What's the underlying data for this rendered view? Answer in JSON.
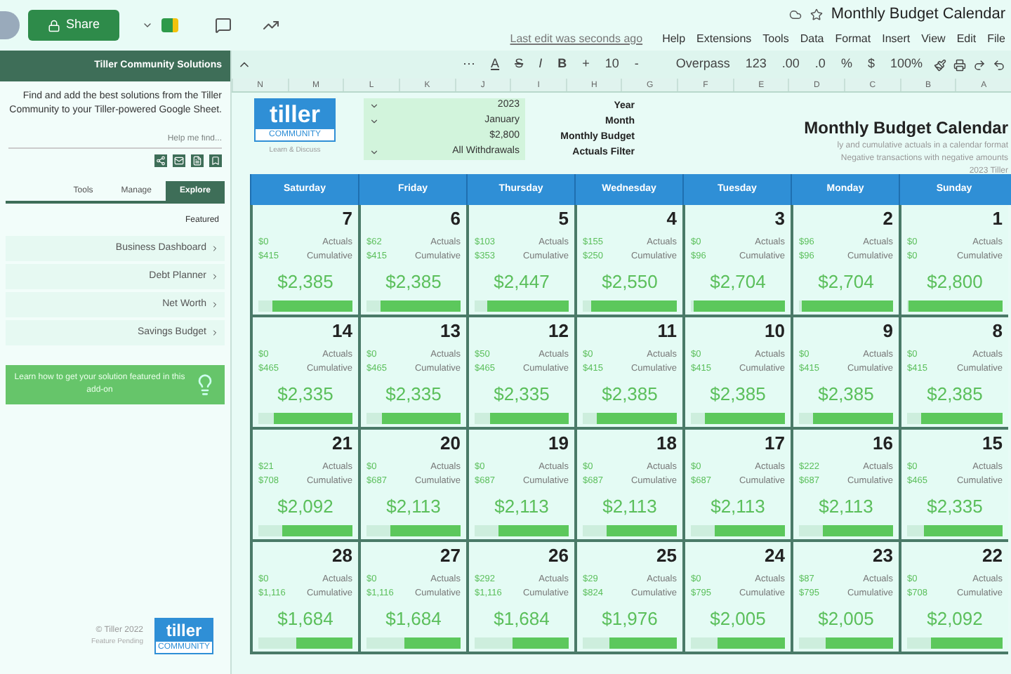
{
  "document": {
    "share": "Share",
    "last_edit": "Last edit was seconds ago",
    "menus": [
      "Help",
      "Extensions",
      "Tools",
      "Data",
      "Format",
      "Insert",
      "View",
      "Edit",
      "File"
    ],
    "title": "Monthly Budget Calendar"
  },
  "toolbar": {
    "more": "⋯",
    "text_color": "A",
    "strike": "S",
    "italic": "I",
    "bold": "B",
    "plus": "+",
    "font_size": "10",
    "minus": "-",
    "font": "Overpass",
    "number_format": "123",
    "decimals_more": ".00",
    "decimals_less": ".0",
    "percent": "%",
    "currency": "$",
    "zoom": "100%"
  },
  "sidebar": {
    "title": "Tiller Community Solutions",
    "intro": "Find and add the best solutions from the Tiller Community to your Tiller-powered Google Sheet.",
    "search": {
      "placeholder": "Help me find..."
    },
    "tabs": [
      {
        "label": "Tools",
        "selected": false
      },
      {
        "label": "Manage",
        "selected": false
      },
      {
        "label": "Explore",
        "selected": true
      }
    ],
    "section": "Featured",
    "items": [
      "Business Dashboard",
      "Debt Planner",
      "Net Worth",
      "Savings Budget"
    ],
    "banner": "Learn how to get your solution featured in this add-on",
    "footer": {
      "logo_word": "tiller",
      "logo_tag": "COMMUNITY",
      "copyright": "© Tiller 2022",
      "note": "Feature Pending"
    }
  },
  "columns": [
    "N",
    "M",
    "L",
    "K",
    "J",
    "I",
    "H",
    "G",
    "F",
    "E",
    "D",
    "C",
    "B",
    "A"
  ],
  "sheet": {
    "logo_word": "tiller",
    "logo_tag": "COMMUNITY",
    "logo_caption": "Learn & Discuss",
    "settings": [
      {
        "label": "Year",
        "value": "2023",
        "dropdown": true
      },
      {
        "label": "Month",
        "value": "January",
        "dropdown": true
      },
      {
        "label": "Monthly Budget",
        "value": "$2,800",
        "dropdown": false
      },
      {
        "label": "Actuals Filter",
        "value": "All Withdrawals",
        "dropdown": true
      }
    ],
    "title": "Monthly Budget Calendar",
    "description": [
      "ly and cumulative actuals in a calendar format",
      "Negative transactions with negative amounts",
      "2023 Tiller"
    ],
    "weekdays": [
      "Saturday",
      "Friday",
      "Thursday",
      "Wednesday",
      "Tuesday",
      "Monday",
      "Sunday"
    ],
    "weeks": [
      [
        {
          "day": "7",
          "actuals": "$0",
          "cumulative": "$415",
          "remaining": "$2,385",
          "level": 0.85,
          "actuals_label": "Actuals",
          "cumulative_label": "Cumulative"
        },
        {
          "day": "6",
          "actuals": "$62",
          "cumulative": "$415",
          "remaining": "$2,385",
          "level": 0.85,
          "actuals_label": "Actuals",
          "cumulative_label": "Cumulative"
        },
        {
          "day": "5",
          "actuals": "$103",
          "cumulative": "$353",
          "remaining": "$2,447",
          "level": 0.87,
          "actuals_label": "Actuals",
          "cumulative_label": "Cumulative"
        },
        {
          "day": "4",
          "actuals": "$155",
          "cumulative": "$250",
          "remaining": "$2,550",
          "level": 0.91,
          "actuals_label": "Actuals",
          "cumulative_label": "Cumulative"
        },
        {
          "day": "3",
          "actuals": "$0",
          "cumulative": "$96",
          "remaining": "$2,704",
          "level": 0.97,
          "actuals_label": "Actuals",
          "cumulative_label": "Cumulative"
        },
        {
          "day": "2",
          "actuals": "$96",
          "cumulative": "$96",
          "remaining": "$2,704",
          "level": 0.97,
          "actuals_label": "Actuals",
          "cumulative_label": "Cumulative"
        },
        {
          "day": "1",
          "actuals": "$0",
          "cumulative": "$0",
          "remaining": "$2,800",
          "level": 0.98,
          "actuals_label": "Actuals",
          "cumulative_label": "Cumulative"
        }
      ],
      [
        {
          "day": "14",
          "actuals": "$0",
          "cumulative": "$465",
          "remaining": "$2,335",
          "level": 0.83,
          "actuals_label": "Actuals",
          "cumulative_label": "Cumulative"
        },
        {
          "day": "13",
          "actuals": "$0",
          "cumulative": "$465",
          "remaining": "$2,335",
          "level": 0.83,
          "actuals_label": "Actuals",
          "cumulative_label": "Cumulative"
        },
        {
          "day": "12",
          "actuals": "$50",
          "cumulative": "$465",
          "remaining": "$2,335",
          "level": 0.83,
          "actuals_label": "Actuals",
          "cumulative_label": "Cumulative"
        },
        {
          "day": "11",
          "actuals": "$0",
          "cumulative": "$415",
          "remaining": "$2,385",
          "level": 0.85,
          "actuals_label": "Actuals",
          "cumulative_label": "Cumulative"
        },
        {
          "day": "10",
          "actuals": "$0",
          "cumulative": "$415",
          "remaining": "$2,385",
          "level": 0.85,
          "actuals_label": "Actuals",
          "cumulative_label": "Cumulative"
        },
        {
          "day": "9",
          "actuals": "$0",
          "cumulative": "$415",
          "remaining": "$2,385",
          "level": 0.85,
          "actuals_label": "Actuals",
          "cumulative_label": "Cumulative"
        },
        {
          "day": "8",
          "actuals": "$0",
          "cumulative": "$415",
          "remaining": "$2,385",
          "level": 0.85,
          "actuals_label": "Actuals",
          "cumulative_label": "Cumulative"
        }
      ],
      [
        {
          "day": "21",
          "actuals": "$21",
          "cumulative": "$708",
          "remaining": "$2,092",
          "level": 0.75,
          "actuals_label": "Actuals",
          "cumulative_label": "Cumulative"
        },
        {
          "day": "20",
          "actuals": "$0",
          "cumulative": "$687",
          "remaining": "$2,113",
          "level": 0.75,
          "actuals_label": "Actuals",
          "cumulative_label": "Cumulative"
        },
        {
          "day": "19",
          "actuals": "$0",
          "cumulative": "$687",
          "remaining": "$2,113",
          "level": 0.75,
          "actuals_label": "Actuals",
          "cumulative_label": "Cumulative"
        },
        {
          "day": "18",
          "actuals": "$0",
          "cumulative": "$687",
          "remaining": "$2,113",
          "level": 0.75,
          "actuals_label": "Actuals",
          "cumulative_label": "Cumulative"
        },
        {
          "day": "17",
          "actuals": "$0",
          "cumulative": "$687",
          "remaining": "$2,113",
          "level": 0.75,
          "actuals_label": "Actuals",
          "cumulative_label": "Cumulative"
        },
        {
          "day": "16",
          "actuals": "$222",
          "cumulative": "$687",
          "remaining": "$2,113",
          "level": 0.75,
          "actuals_label": "Actuals",
          "cumulative_label": "Cumulative"
        },
        {
          "day": "15",
          "actuals": "$0",
          "cumulative": "$465",
          "remaining": "$2,335",
          "level": 0.83,
          "actuals_label": "Actuals",
          "cumulative_label": "Cumulative"
        }
      ],
      [
        {
          "day": "28",
          "actuals": "$0",
          "cumulative": "$1,116",
          "remaining": "$1,684",
          "level": 0.6,
          "actuals_label": "Actuals",
          "cumulative_label": "Cumulative"
        },
        {
          "day": "27",
          "actuals": "$0",
          "cumulative": "$1,116",
          "remaining": "$1,684",
          "level": 0.6,
          "actuals_label": "Actuals",
          "cumulative_label": "Cumulative"
        },
        {
          "day": "26",
          "actuals": "$292",
          "cumulative": "$1,116",
          "remaining": "$1,684",
          "level": 0.6,
          "actuals_label": "Actuals",
          "cumulative_label": "Cumulative"
        },
        {
          "day": "25",
          "actuals": "$29",
          "cumulative": "$824",
          "remaining": "$1,976",
          "level": 0.71,
          "actuals_label": "Actuals",
          "cumulative_label": "Cumulative"
        },
        {
          "day": "24",
          "actuals": "$0",
          "cumulative": "$795",
          "remaining": "$2,005",
          "level": 0.72,
          "actuals_label": "Actuals",
          "cumulative_label": "Cumulative"
        },
        {
          "day": "23",
          "actuals": "$87",
          "cumulative": "$795",
          "remaining": "$2,005",
          "level": 0.72,
          "actuals_label": "Actuals",
          "cumulative_label": "Cumulative"
        },
        {
          "day": "22",
          "actuals": "$0",
          "cumulative": "$708",
          "remaining": "$2,092",
          "level": 0.75,
          "actuals_label": "Actuals",
          "cumulative_label": "Cumulative"
        }
      ]
    ]
  }
}
